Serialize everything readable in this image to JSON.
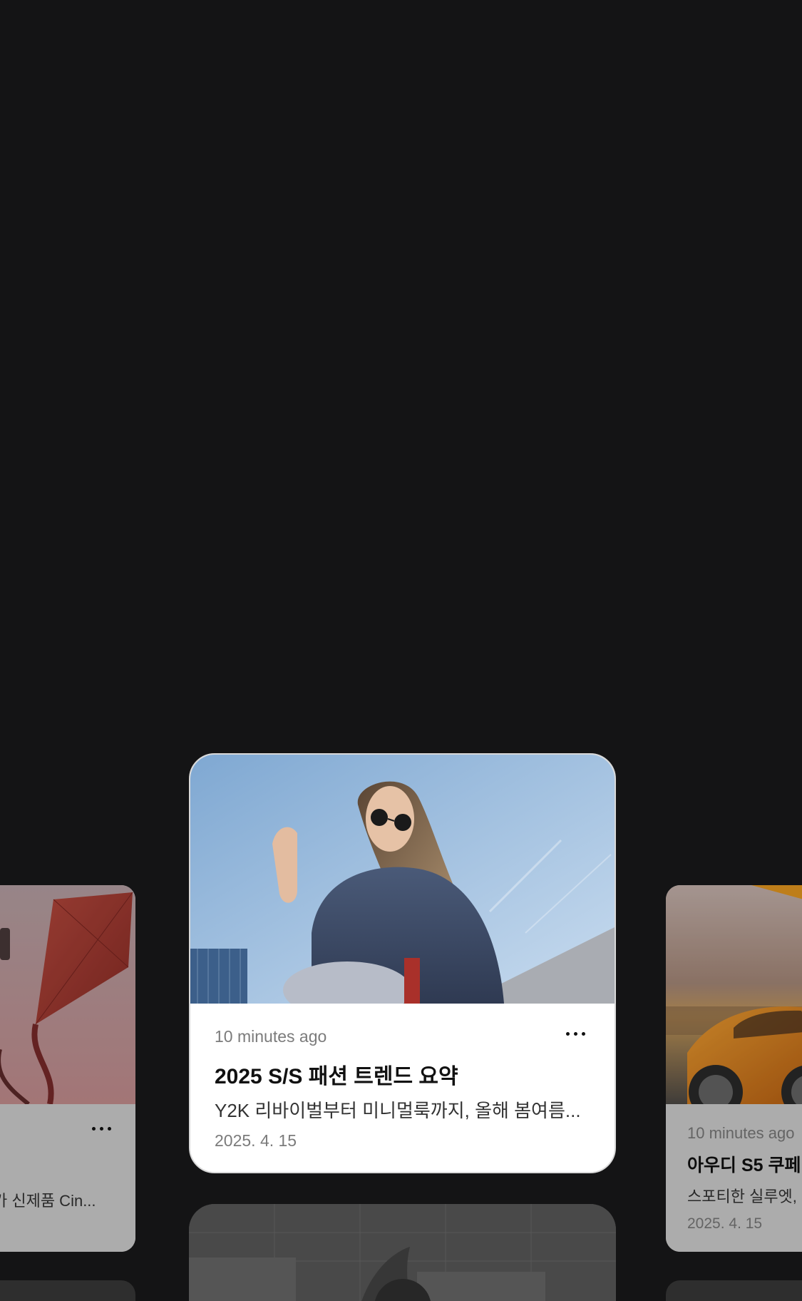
{
  "cards": {
    "center": {
      "time": "10 minutes ago",
      "title": "2025 S/S 패션 트렌드 요약",
      "summary": "Y2K 리바이벌부터 미니멀룩까지, 올해 봄여름...",
      "date": "2025. 4. 15",
      "image": "woman-sunglasses-photo"
    },
    "left": {
      "summary": "가 신제품 Cin...",
      "image": "red-kite-photo"
    },
    "right": {
      "time": "10 minutes ago",
      "title": "아우디 S5 쿠페",
      "summary": "스포티한 실루엣,",
      "date": "2025. 4. 15",
      "image": "orange-car-photo"
    },
    "bottom": {
      "image": "instructions-sign-photo"
    }
  },
  "colors": {
    "background": "#141415",
    "card": "#ffffff",
    "muted_text": "#7b7b7b"
  }
}
